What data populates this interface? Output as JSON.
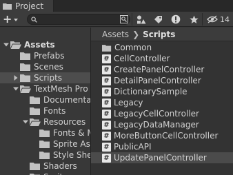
{
  "tab": {
    "title": "Project"
  },
  "toolbar": {
    "search_placeholder": "",
    "hidden_count": "14"
  },
  "tree": [
    {
      "label": "Assets",
      "bold": true,
      "expanded": true,
      "depth": 0,
      "arrow": "down"
    },
    {
      "label": "Prefabs",
      "depth": 1,
      "arrow": "none"
    },
    {
      "label": "Scenes",
      "depth": 1,
      "arrow": "none"
    },
    {
      "label": "Scripts",
      "depth": 1,
      "arrow": "right",
      "selected": true
    },
    {
      "label": "TextMesh Pro",
      "depth": 1,
      "arrow": "down"
    },
    {
      "label": "Documentation",
      "depth": 2,
      "arrow": "none"
    },
    {
      "label": "Fonts",
      "depth": 2,
      "arrow": "none"
    },
    {
      "label": "Resources",
      "depth": 2,
      "arrow": "down"
    },
    {
      "label": "Fonts & Materials",
      "depth": 3,
      "arrow": "none"
    },
    {
      "label": "Sprite Assets",
      "depth": 3,
      "arrow": "none"
    },
    {
      "label": "Style Sheets",
      "depth": 3,
      "arrow": "none"
    },
    {
      "label": "Shaders",
      "depth": 2,
      "arrow": "none"
    },
    {
      "label": "Sprites",
      "depth": 2,
      "arrow": "none"
    }
  ],
  "breadcrumb": {
    "root": "Assets",
    "current": "Scripts"
  },
  "files": [
    {
      "label": "Common",
      "kind": "folder"
    },
    {
      "label": "CellController",
      "kind": "script"
    },
    {
      "label": "CreatePanelController",
      "kind": "script"
    },
    {
      "label": "DetailPanelController",
      "kind": "script"
    },
    {
      "label": "DictionarySample",
      "kind": "script"
    },
    {
      "label": "Legacy",
      "kind": "script"
    },
    {
      "label": "LegacyCellController",
      "kind": "script"
    },
    {
      "label": "LegacyDataManager",
      "kind": "script"
    },
    {
      "label": "MoreButtonCellController",
      "kind": "script"
    },
    {
      "label": "PublicAPI",
      "kind": "script"
    },
    {
      "label": "UpdatePanelController",
      "kind": "script",
      "selected": true
    }
  ],
  "colors": {
    "selected_row": "#4d4d4d",
    "folder": "#c2c2c2",
    "script_icon": "#e8e8e8"
  }
}
